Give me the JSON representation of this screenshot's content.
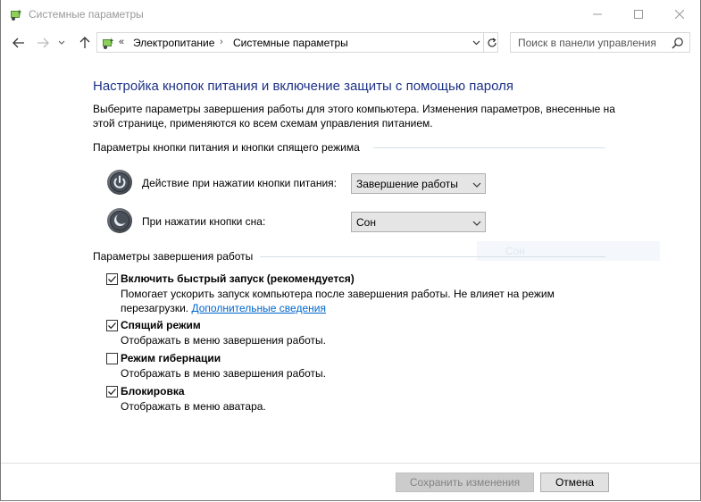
{
  "window": {
    "title": "Системные параметры"
  },
  "address_bar": {
    "overflow_chevrons": "«",
    "breadcrumbs": [
      "Электропитание",
      "Системные параметры"
    ],
    "separator": "›"
  },
  "search": {
    "placeholder": "Поиск в панели управления"
  },
  "page": {
    "heading": "Настройка кнопок питания и включение защиты с помощью пароля",
    "description": "Выберите параметры завершения работы для этого компьютера. Изменения параметров, внесенные на этой странице, применяются ко всем схемам управления питанием."
  },
  "power_buttons_section": {
    "title": "Параметры кнопки питания и кнопки спящего режима",
    "rows": [
      {
        "label": "Действие при нажатии кнопки питания:",
        "value": "Завершение работы",
        "icon": "power-button-icon"
      },
      {
        "label": "При нажатии кнопки сна:",
        "value": "Сон",
        "icon": "sleep-button-icon"
      }
    ]
  },
  "ghost_option": "Сон",
  "shutdown_section": {
    "title": "Параметры завершения работы",
    "options": [
      {
        "title": "Включить быстрый запуск (рекомендуется)",
        "description": "Помогает ускорить запуск компьютера после завершения работы. Не влияет на режим перезагрузки.",
        "link": "Дополнительные сведения",
        "checked": true
      },
      {
        "title": "Спящий режим",
        "description": "Отображать в меню завершения работы.",
        "checked": true
      },
      {
        "title": "Режим гибернации",
        "description": "Отображать в меню завершения работы.",
        "checked": false
      },
      {
        "title": "Блокировка",
        "description": "Отображать в меню аватара.",
        "checked": true
      }
    ]
  },
  "footer": {
    "save_label": "Сохранить изменения",
    "cancel_label": "Отмена"
  },
  "colors": {
    "heading": "#1e3287",
    "link": "#0066cc",
    "disabled_button": "#cccccc"
  }
}
